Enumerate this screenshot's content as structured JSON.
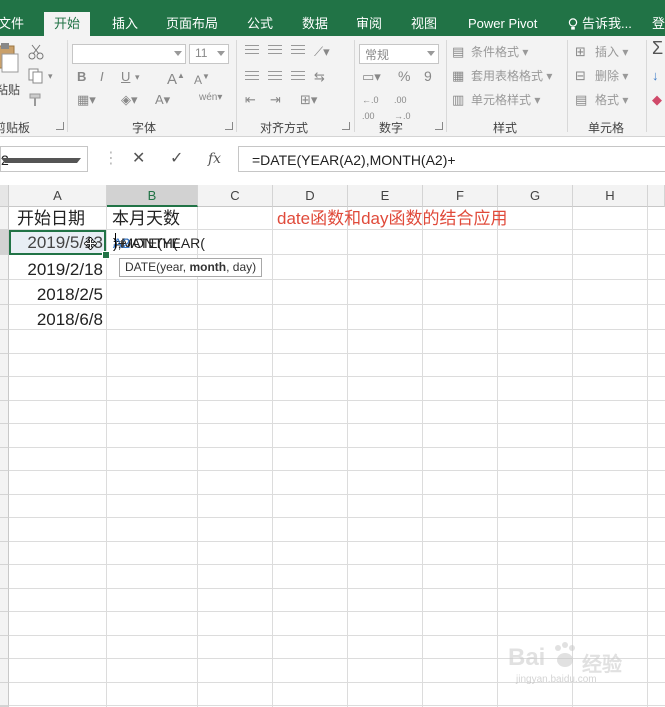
{
  "ribbon_tabs": [
    {
      "label": "文件"
    },
    {
      "label": "开始",
      "active": true
    },
    {
      "label": "插入"
    },
    {
      "label": "页面布局"
    },
    {
      "label": "公式"
    },
    {
      "label": "数据"
    },
    {
      "label": "审阅"
    },
    {
      "label": "视图"
    },
    {
      "label": "Power Pivot"
    }
  ],
  "tell_me": "告诉我...",
  "user_initial": "登",
  "ribbon": {
    "clipboard": {
      "paste_label": "粘贴",
      "group_label": "剪贴板"
    },
    "font": {
      "font_name": "",
      "font_size": "11",
      "bold": "B",
      "italic": "I",
      "underline": "U",
      "wen": "wén",
      "group_label": "字体"
    },
    "alignment": {
      "group_label": "对齐方式"
    },
    "number": {
      "format": "常规",
      "percent": "%",
      "comma": "9",
      "group_label": "数字"
    },
    "styles": {
      "conditional": "条件格式",
      "table": "套用表格格式",
      "cell": "单元格样式",
      "group_label": "样式"
    },
    "cells": {
      "insert": "插入",
      "delete": "删除",
      "format": "格式",
      "group_label": "单元格"
    },
    "editing": {
      "sum_icon": "Σ"
    }
  },
  "formula_bar": {
    "name_box": "2",
    "fx": "fx",
    "formula": "=DATE(YEAR(A2),MONTH(A2)+"
  },
  "columns": [
    "A",
    "B",
    "C",
    "D",
    "E",
    "F",
    "G",
    "H"
  ],
  "selected_column": "B",
  "cells": {
    "A1": "开始日期",
    "B1": "本月天数",
    "D1": "date函数和day函数的结合应用",
    "A2": "2019/5/13",
    "A3": "2019/2/18",
    "A4": "2018/2/5",
    "A5": "2018/6/8"
  },
  "editing_cell": {
    "prefix": "=DATE(YEAR(",
    "ref1": "A2",
    "mid": "),MONTH(",
    "ref2": "A2",
    "suffix": ")+"
  },
  "tooltip": {
    "prefix": "DATE(year, ",
    "bold_arg": "month",
    "suffix": ", day)"
  },
  "watermark": {
    "brand": "Bai",
    "brand2": "经验",
    "url": "jingyan.baidu.com"
  },
  "colors": {
    "excel_green": "#217346",
    "annotation_red": "#e04a3a",
    "ref_blue": "#3c7bc8"
  }
}
